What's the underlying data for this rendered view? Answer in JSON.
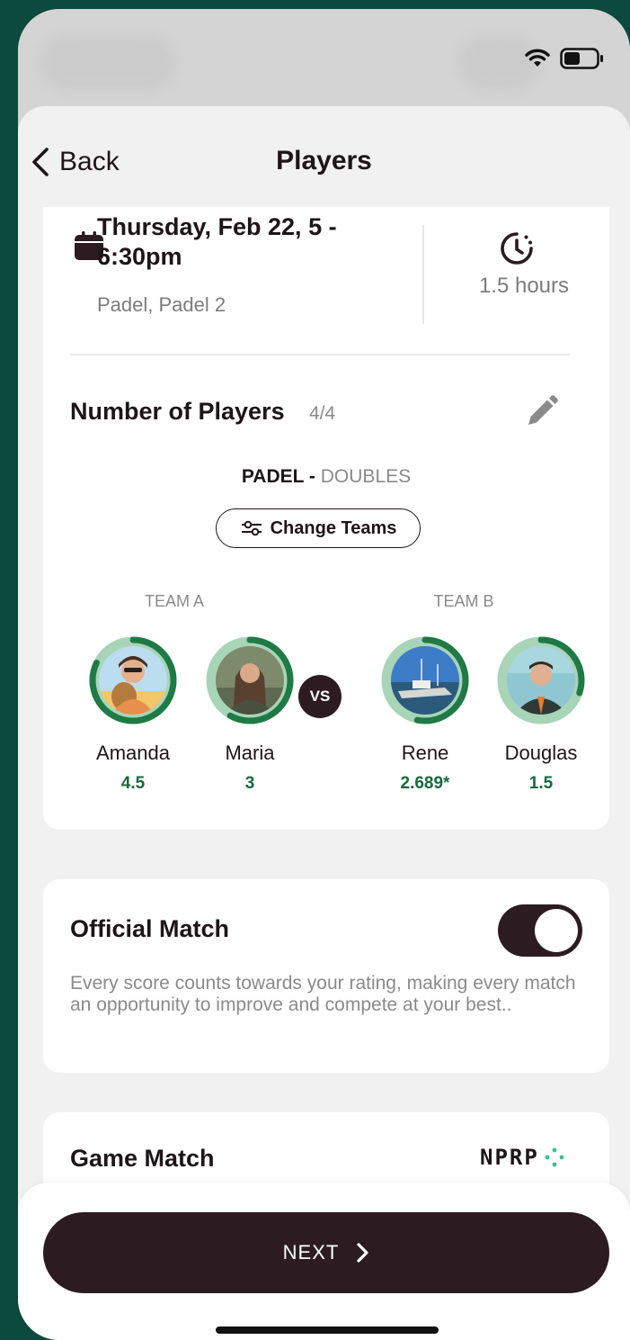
{
  "nav": {
    "back_label": "Back",
    "title": "Players"
  },
  "booking": {
    "date": "Thursday, Feb 22, 5 - 6:30pm",
    "venue": "Padel, Padel 2",
    "duration": "1.5 hours"
  },
  "players_section": {
    "heading": "Number of Players",
    "count": "4/4",
    "sport": "PADEL",
    "separator": " - ",
    "format": "DOUBLES",
    "change_teams_label": "Change Teams",
    "vs_label": "VS",
    "team_a": {
      "label": "TEAM A",
      "players": [
        {
          "name": "Amanda",
          "rating": "4.5",
          "ring_progress": 0.82,
          "avatar_colors": [
            "#f3c766",
            "#e8904d"
          ]
        },
        {
          "name": "Maria",
          "rating": "3",
          "ring_progress": 0.58,
          "avatar_colors": [
            "#7d8a6c",
            "#4a4f3e"
          ]
        }
      ]
    },
    "team_b": {
      "label": "TEAM B",
      "players": [
        {
          "name": "Rene",
          "rating": "2.689*",
          "ring_progress": 0.53,
          "avatar_colors": [
            "#3d7cc7",
            "#d7d7d2"
          ]
        },
        {
          "name": "Douglas",
          "rating": "1.5",
          "ring_progress": 0.3,
          "avatar_colors": [
            "#8ec7d2",
            "#2f3a36"
          ]
        }
      ]
    }
  },
  "official_match": {
    "title": "Official Match",
    "enabled": true,
    "description": "Every score counts towards your rating, making every match an opportunity to improve and compete at your best.."
  },
  "game_match": {
    "title": "Game Match",
    "logo_text": "NPRP"
  },
  "footer": {
    "next_label": "NEXT"
  },
  "colors": {
    "accent_dark": "#2c1c22",
    "rating_green": "#19693f",
    "ring_green": "#1f7a45",
    "ring_track": "#a8d4b8",
    "background": "#0b4a3c"
  }
}
